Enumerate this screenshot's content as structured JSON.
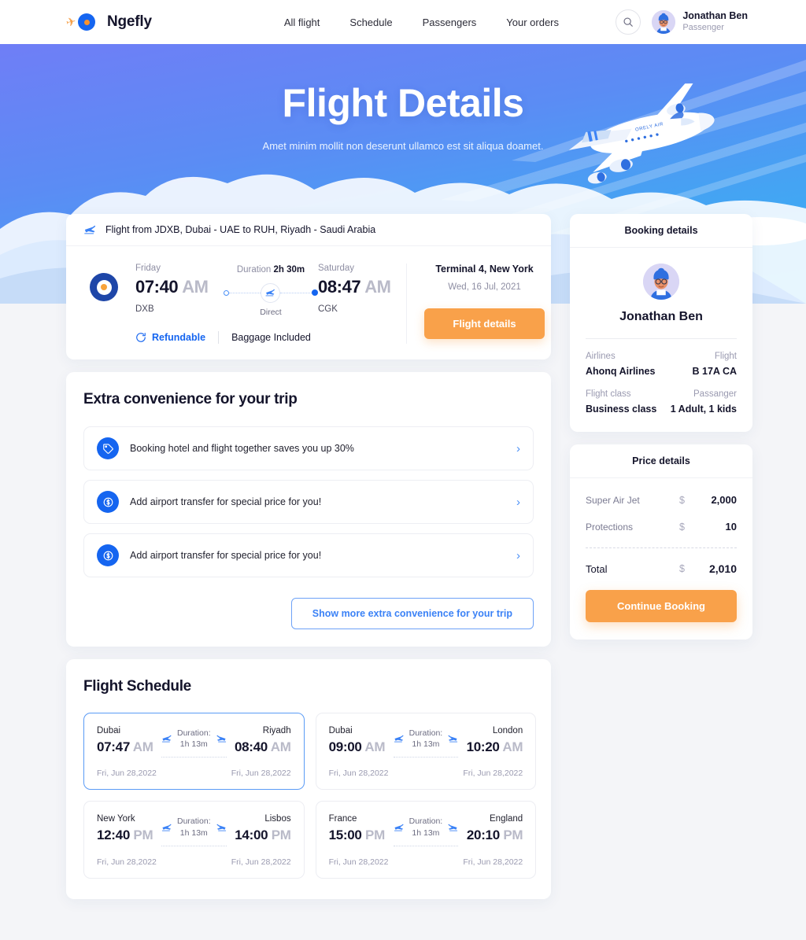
{
  "header": {
    "brand": "Ngefly",
    "nav": [
      {
        "label": "All flight"
      },
      {
        "label": "Schedule"
      },
      {
        "label": "Passengers"
      },
      {
        "label": "Your orders"
      }
    ],
    "search_icon": "search-icon",
    "user": {
      "name": "Jonathan Ben",
      "role": "Passenger"
    }
  },
  "hero": {
    "title": "Flight Details",
    "subtitle": "Amet minim mollit non deserunt ullamco est sit aliqua doamet.",
    "plane_label": "ORELY AIR"
  },
  "flight_card": {
    "route_title": "Flight from JDXB, Dubai - UAE to RUH, Riyadh - Saudi Arabia",
    "depart": {
      "day": "Friday",
      "time": "07:40",
      "meridiem": "AM",
      "code": "DXB"
    },
    "arrive": {
      "day": "Saturday",
      "time": "08:47",
      "meridiem": "AM",
      "code": "CGK"
    },
    "duration_label": "Duration",
    "duration_value": "2h 30m",
    "stops": "Direct",
    "terminal": "Terminal 4, New York",
    "date": "Wed, 16 Jul, 2021",
    "details_button": "Flight details",
    "refundable": "Refundable",
    "baggage": "Baggage Included"
  },
  "extra": {
    "title": "Extra convenience for your trip",
    "items": [
      {
        "text": "Booking hotel and flight together saves you up 30%",
        "icon": "tag-icon"
      },
      {
        "text": "Add airport transfer for special price for you!",
        "icon": "dollar-coin-icon"
      },
      {
        "text": "Add airport transfer for special price for you!",
        "icon": "dollar-coin-icon"
      }
    ],
    "show_more": "Show more extra convenience for your trip"
  },
  "schedule": {
    "title": "Flight Schedule",
    "duration_label": "Duration:",
    "items": [
      {
        "from_city": "Dubai",
        "from_time": "07:47",
        "from_meridiem": "AM",
        "from_date": "Fri, Jun 28,2022",
        "to_city": "Riyadh",
        "to_time": "08:40",
        "to_meridiem": "AM",
        "to_date": "Fri, Jun 28,2022",
        "duration": "1h 13m",
        "selected": true
      },
      {
        "from_city": "Dubai",
        "from_time": "09:00",
        "from_meridiem": "AM",
        "from_date": "Fri, Jun 28,2022",
        "to_city": "London",
        "to_time": "10:20",
        "to_meridiem": "AM",
        "to_date": "Fri, Jun 28,2022",
        "duration": "1h 13m",
        "selected": false
      },
      {
        "from_city": "New York",
        "from_time": "12:40",
        "from_meridiem": "PM",
        "from_date": "Fri, Jun 28,2022",
        "to_city": "Lisbos",
        "to_time": "14:00",
        "to_meridiem": "PM",
        "to_date": "Fri, Jun 28,2022",
        "duration": "1h 13m",
        "selected": false
      },
      {
        "from_city": "France",
        "from_time": "15:00",
        "from_meridiem": "PM",
        "from_date": "Fri, Jun 28,2022",
        "to_city": "England",
        "to_time": "20:10",
        "to_meridiem": "PM",
        "to_date": "Fri, Jun 28,2022",
        "duration": "1h 13m",
        "selected": false
      }
    ]
  },
  "booking_details": {
    "title": "Booking details",
    "passenger_name": "Jonathan Ben",
    "airlines_label": "Airlines",
    "airlines_value": "Ahonq Airlines",
    "flight_label": "Flight",
    "flight_value": "B 17A CA",
    "class_label": "Flight class",
    "class_value": "Business class",
    "passenger_label": "Passanger",
    "passenger_value": "1 Adult, 1 kids"
  },
  "price_details": {
    "title": "Price details",
    "rows": [
      {
        "label": "Super Air Jet",
        "currency": "$",
        "value": "2,000"
      },
      {
        "label": "Protections",
        "currency": "$",
        "value": "10"
      }
    ],
    "total_label": "Total",
    "total_currency": "$",
    "total_value": "2,010",
    "continue_button": "Continue Booking"
  },
  "colors": {
    "brand_blue": "#1565f0",
    "accent_orange": "#f9a14a",
    "page_bg": "#f4f5f8",
    "text_dark": "#14142b",
    "text_muted": "#9a9ab0"
  }
}
